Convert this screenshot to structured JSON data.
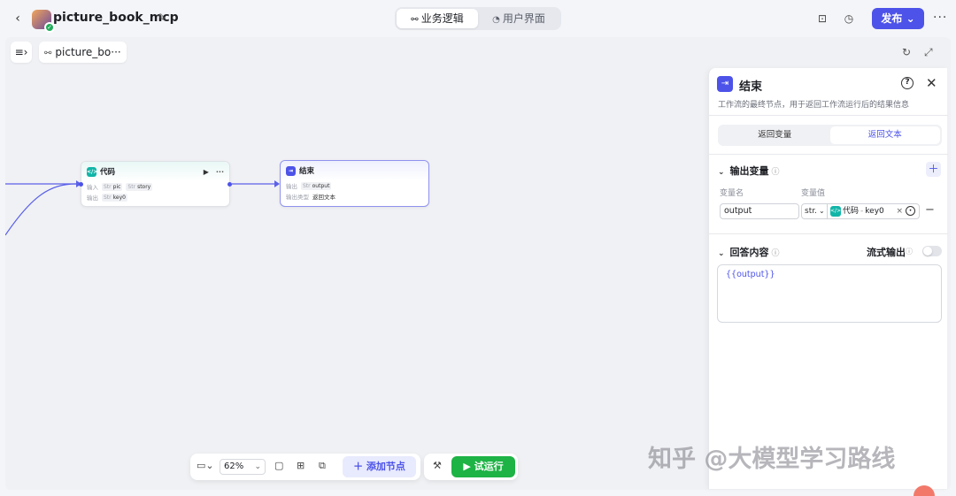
{
  "header": {
    "back_icon": "chevron-left-icon",
    "app_title": "picture_book_mcp",
    "tabs": [
      {
        "label": "业务逻辑",
        "icon": "workflow-icon",
        "active": true
      },
      {
        "label": "用户界面",
        "icon": "palette-icon",
        "active": false
      }
    ],
    "publish_label": "发布",
    "accent_color": "#4d53e8"
  },
  "canvas": {
    "breadcrumb_label": "picture_bo···",
    "nodes": {
      "code": {
        "title": "代码",
        "input_label": "输入",
        "inputs": [
          {
            "type": "Str",
            "name": "pic"
          },
          {
            "type": "Str",
            "name": "story"
          }
        ],
        "output_label": "输出",
        "outputs": [
          {
            "type": "Str",
            "name": "key0"
          }
        ]
      },
      "end": {
        "title": "结束",
        "output_label": "输出",
        "outputs": [
          {
            "type": "Str",
            "name": "output"
          }
        ],
        "mode_label": "输出类型",
        "mode_value": "返回文本"
      }
    }
  },
  "toolbar": {
    "zoom": "62%",
    "add_node_label": "添加节点",
    "run_label": "试运行"
  },
  "panel": {
    "title": "结束",
    "description": "工作流的最终节点，用于返回工作流运行后的结果信息",
    "tabs": [
      {
        "label": "返回变量",
        "active": false
      },
      {
        "label": "返回文本",
        "active": true
      }
    ],
    "output_section": {
      "title": "输出变量",
      "col_name": "变量名",
      "col_value": "变量值",
      "row": {
        "name": "output",
        "type": "str.",
        "ref_node": "代码",
        "ref_sep": "-",
        "ref_var": "key0"
      }
    },
    "answer_section": {
      "title": "回答内容",
      "stream_label": "流式输出",
      "stream_on": false,
      "content": "{{output}}"
    }
  },
  "watermark": "知乎 @大模型学习路线"
}
